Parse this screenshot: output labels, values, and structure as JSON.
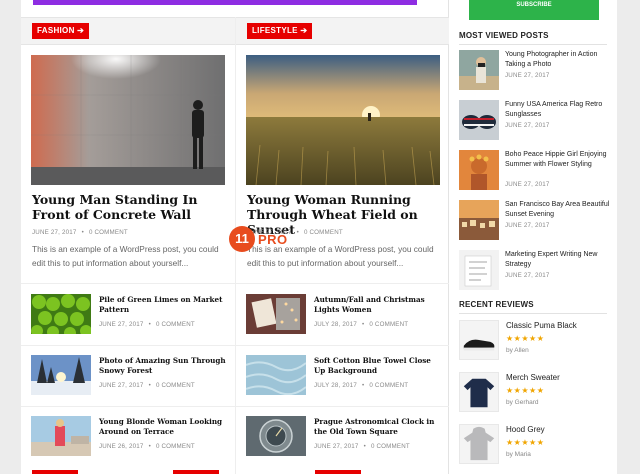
{
  "main": {
    "columns": [
      {
        "category": "FASHION ➔",
        "featured": {
          "title": "Young Man Standing In Front of Concrete Wall",
          "date": "JUNE 27, 2017",
          "comments": "0 COMMENT",
          "excerpt": "This is an example of a WordPress post, you could edit this to put information about yourself..."
        },
        "items": [
          {
            "title": "Pile of Green Limes on Market Pattern",
            "date": "JUNE 27, 2017",
            "comments": "0 COMMENT"
          },
          {
            "title": "Photo of Amazing Sun Through Snowy Forest",
            "date": "JUNE 27, 2017",
            "comments": "0 COMMENT"
          },
          {
            "title": "Young Blonde Woman Looking Around on Terrace",
            "date": "JUNE 26, 2017",
            "comments": "0 COMMENT"
          }
        ]
      },
      {
        "category": "LIFESTYLE ➔",
        "featured": {
          "title": "Young Woman Running Through Wheat Field on Sunset",
          "date": "JUNE 27, 2017",
          "comments": "0 COMMENT",
          "excerpt": "This is an example of a WordPress post, you could edit this to put information about yourself..."
        },
        "items": [
          {
            "title": "Autumn/Fall and Christmas Lights Women",
            "date": "JULY 28, 2017",
            "comments": "0 COMMENT"
          },
          {
            "title": "Soft Cotton Blue Towel Close Up Background",
            "date": "JULY 28, 2017",
            "comments": "0 COMMENT"
          },
          {
            "title": "Prague Astronomical Clock in the Old Town Square",
            "date": "JUNE 27, 2017",
            "comments": "0 COMMENT"
          }
        ]
      }
    ],
    "logo": {
      "number": "11",
      "text": "PRO"
    }
  },
  "sidebar": {
    "subscribe_label": "SUBSCRIBE",
    "most_viewed": {
      "heading": "MOST VIEWED POSTS",
      "items": [
        {
          "title": "Young Photographer in Action Taking a Photo",
          "date": "JUNE 27, 2017"
        },
        {
          "title": "Funny USA America Flag Retro Sunglasses",
          "date": "JUNE 27, 2017"
        },
        {
          "title": "Boho Peace Hippie Girl Enjoying Summer with Flower Styling",
          "date": "JUNE 27, 2017"
        },
        {
          "title": "San Francisco Bay Area Beautiful Sunset Evening",
          "date": "JUNE 27, 2017"
        },
        {
          "title": "Marketing Expert Writing New Strategy",
          "date": "JUNE 27, 2017"
        }
      ]
    },
    "recent_reviews": {
      "heading": "RECENT REVIEWS",
      "items": [
        {
          "name": "Classic Puma Black",
          "stars": "★★★★★",
          "by": "by Allen"
        },
        {
          "name": "Merch Sweater",
          "stars": "★★★★★",
          "by": "by Gerhard"
        },
        {
          "name": "Hood Grey",
          "stars": "★★★★★",
          "by": "by Maria"
        }
      ]
    }
  },
  "colors": {
    "accent": "#e60000",
    "subscribe": "#2db34a",
    "logo": "#e84c1e",
    "stars": "#f0a500"
  }
}
